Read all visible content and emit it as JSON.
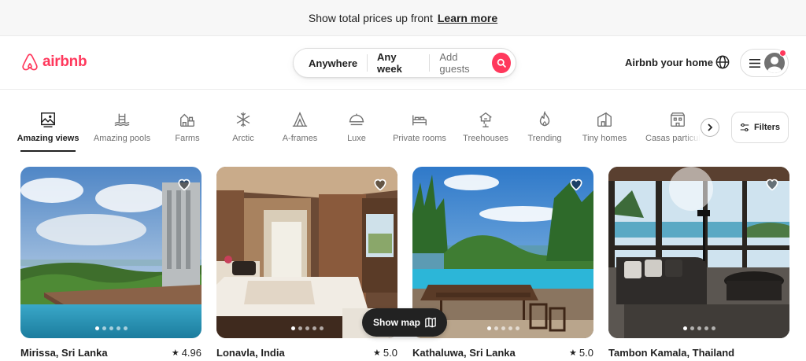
{
  "banner": {
    "message": "Show total prices up front",
    "link": "Learn more"
  },
  "header": {
    "logo": "airbnb",
    "search": {
      "where": "Anywhere",
      "when": "Any week",
      "who": "Add guests"
    },
    "host_link": "Airbnb your home"
  },
  "categories": [
    {
      "label": "Amazing views",
      "icon": "amazing-views-icon",
      "active": true
    },
    {
      "label": "Amazing pools",
      "icon": "pool-icon",
      "active": false
    },
    {
      "label": "Farms",
      "icon": "farm-icon",
      "active": false
    },
    {
      "label": "Arctic",
      "icon": "snowflake-icon",
      "active": false
    },
    {
      "label": "A-frames",
      "icon": "a-frame-icon",
      "active": false
    },
    {
      "label": "Luxe",
      "icon": "luxe-icon",
      "active": false
    },
    {
      "label": "Private rooms",
      "icon": "bed-icon",
      "active": false
    },
    {
      "label": "Treehouses",
      "icon": "treehouse-icon",
      "active": false
    },
    {
      "label": "Trending",
      "icon": "flame-icon",
      "active": false
    },
    {
      "label": "Tiny homes",
      "icon": "tiny-home-icon",
      "active": false
    },
    {
      "label": "Casas particul",
      "icon": "casa-icon",
      "active": false
    }
  ],
  "filters_label": "Filters",
  "listings": [
    {
      "location": "Mirissa, Sri Lanka",
      "rating": "4.96"
    },
    {
      "location": "Lonavla, India",
      "rating": "5.0"
    },
    {
      "location": "Kathaluwa, Sri Lanka",
      "rating": "5.0"
    },
    {
      "location": "Tambon Kamala, Thailand",
      "rating": ""
    }
  ],
  "show_map_label": "Show map",
  "colors": {
    "brand": "#FF385C",
    "text": "#222222",
    "muted": "#717171"
  }
}
